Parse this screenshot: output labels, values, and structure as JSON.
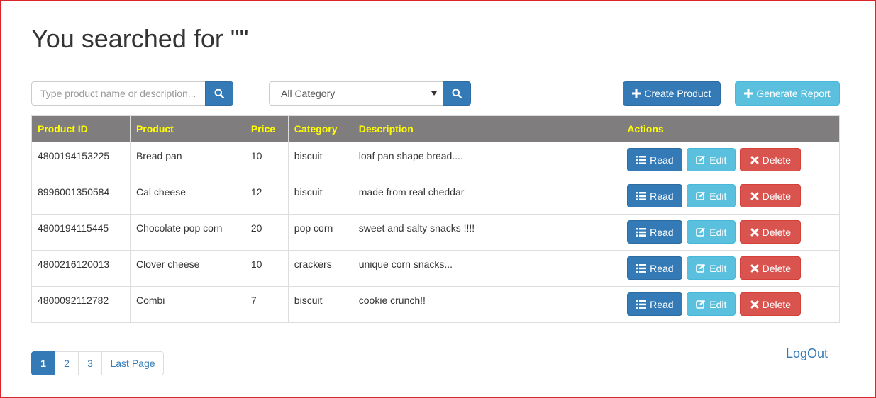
{
  "header": {
    "title": "You searched for \"\""
  },
  "search": {
    "placeholder": "Type product name or description..."
  },
  "category_filter": {
    "selected": "All Category"
  },
  "toolbar": {
    "create_label": "Create Product",
    "report_label": "Generate Report"
  },
  "table": {
    "columns": [
      "Product ID",
      "Product",
      "Price",
      "Category",
      "Description",
      "Actions"
    ],
    "rows": [
      {
        "id": "4800194153225",
        "product": "Bread pan",
        "price": "10",
        "category": "biscuit",
        "description": "loaf pan shape bread...."
      },
      {
        "id": "8996001350584",
        "product": "Cal cheese",
        "price": "12",
        "category": "biscuit",
        "description": "made from real cheddar"
      },
      {
        "id": "4800194115445",
        "product": "Chocolate pop corn",
        "price": "20",
        "category": "pop corn",
        "description": "sweet and salty snacks !!!!"
      },
      {
        "id": "4800216120013",
        "product": "Clover cheese",
        "price": "10",
        "category": "crackers",
        "description": "unique corn snacks..."
      },
      {
        "id": "4800092112782",
        "product": "Combi",
        "price": "7",
        "category": "biscuit",
        "description": "cookie crunch!!"
      }
    ],
    "actions": {
      "read": "Read",
      "edit": "Edit",
      "delete": "Delete"
    }
  },
  "pagination": {
    "pages": [
      "1",
      "2",
      "3"
    ],
    "last": "Last Page",
    "active": "1"
  },
  "logout_label": "LogOut",
  "colors": {
    "primary": "#337ab7",
    "info": "#5bc0de",
    "danger": "#d9534f",
    "header_bg": "#807d7e",
    "header_text": "#ffff00"
  }
}
